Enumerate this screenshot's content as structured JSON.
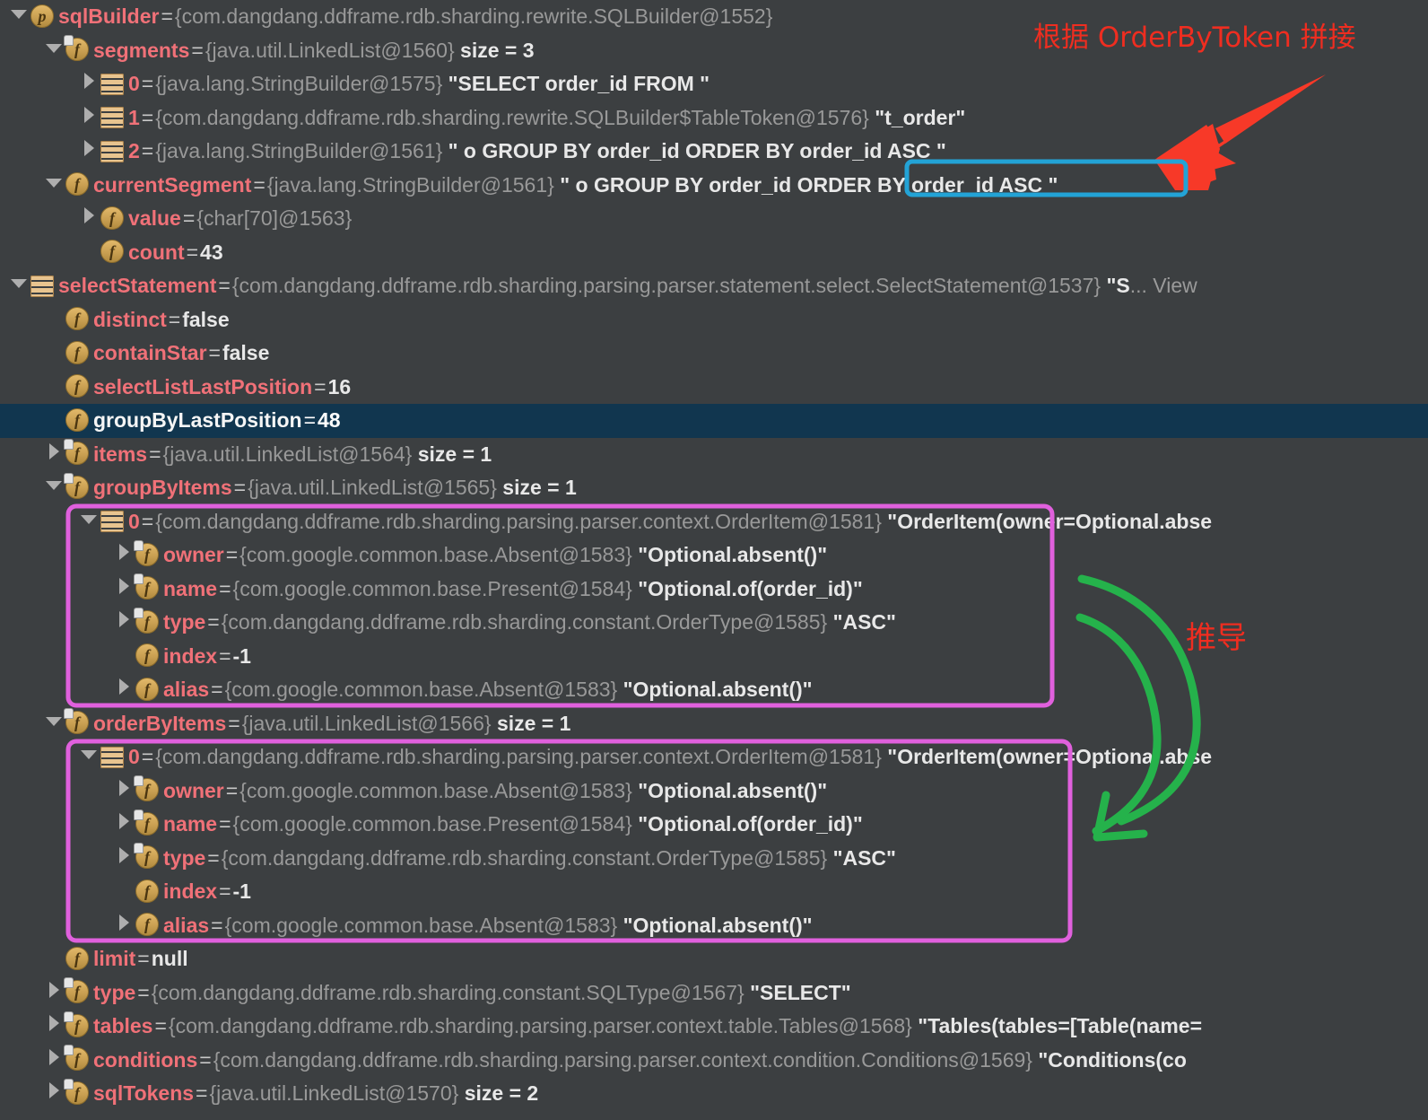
{
  "theme": {
    "background": "#3c3f41",
    "selected_row_bg": "#11364f",
    "field_name_color": "#f07178",
    "type_color": "#999999",
    "value_color": "#e8e8e8",
    "annotation_red": "#ef2d20",
    "highlight_cyan": "#23a3d6",
    "highlight_pink": "#e060dd",
    "arrow_green": "#25b24b"
  },
  "tree": {
    "rows": [
      {
        "indent": 0,
        "twisty": "down",
        "icon": "property-icon",
        "name": "sqlBuilder",
        "eq": "=",
        "type": "{com.dangdang.ddframe.rdb.sharding.rewrite.SQLBuilder@1552}",
        "value": "",
        "size": ""
      },
      {
        "indent": 1,
        "twisty": "down",
        "icon": "field-private-icon",
        "name": "segments",
        "eq": "=",
        "type": "{java.util.LinkedList@1560}",
        "value": "",
        "size": "size = 3"
      },
      {
        "indent": 2,
        "twisty": "right",
        "icon": "list-icon",
        "name": "0",
        "eq": "=",
        "type": "{java.lang.StringBuilder@1575}",
        "value": "\"SELECT order_id FROM \"",
        "size": ""
      },
      {
        "indent": 2,
        "twisty": "right",
        "icon": "list-icon",
        "name": "1",
        "eq": "=",
        "type": "{com.dangdang.ddframe.rdb.sharding.rewrite.SQLBuilder$TableToken@1576}",
        "value": "\"t_order\"",
        "size": ""
      },
      {
        "indent": 2,
        "twisty": "right",
        "icon": "list-icon",
        "name": "2",
        "eq": "=",
        "type": "{java.lang.StringBuilder@1561}",
        "value": "\" o GROUP BY order_id ORDER BY order_id ASC \"",
        "size": ""
      },
      {
        "indent": 1,
        "twisty": "down",
        "icon": "field-icon",
        "name": "currentSegment",
        "eq": "=",
        "type": "{java.lang.StringBuilder@1561}",
        "value": "\" o GROUP BY order_id ORDER BY order_id ASC \"",
        "size": ""
      },
      {
        "indent": 2,
        "twisty": "right",
        "icon": "field-icon",
        "name": "value",
        "eq": "=",
        "type": "{char[70]@1563}",
        "value": "",
        "size": ""
      },
      {
        "indent": 2,
        "twisty": "none",
        "icon": "field-icon",
        "name": "count",
        "eq": "=",
        "type": "",
        "value": "43",
        "size": ""
      },
      {
        "indent": 0,
        "twisty": "down",
        "icon": "list-icon",
        "name": "selectStatement",
        "eq": "=",
        "type": "{com.dangdang.ddframe.rdb.sharding.parsing.parser.statement.select.SelectStatement@1537}",
        "value": "\"S",
        "size": "",
        "trail": "... View"
      },
      {
        "indent": 1,
        "twisty": "none",
        "icon": "field-icon",
        "name": "distinct",
        "eq": "=",
        "type": "",
        "value": "false",
        "size": ""
      },
      {
        "indent": 1,
        "twisty": "none",
        "icon": "field-icon",
        "name": "containStar",
        "eq": "=",
        "type": "",
        "value": "false",
        "size": ""
      },
      {
        "indent": 1,
        "twisty": "none",
        "icon": "field-icon",
        "name": "selectListLastPosition",
        "eq": "=",
        "type": "",
        "value": "16",
        "size": ""
      },
      {
        "indent": 1,
        "twisty": "none",
        "icon": "field-icon",
        "name": "groupByLastPosition",
        "eq": "=",
        "type": "",
        "value": "48",
        "size": "",
        "selected": true
      },
      {
        "indent": 1,
        "twisty": "right",
        "icon": "field-private-icon",
        "name": "items",
        "eq": "=",
        "type": "{java.util.LinkedList@1564}",
        "value": "",
        "size": "size = 1"
      },
      {
        "indent": 1,
        "twisty": "down",
        "icon": "field-private-icon",
        "name": "groupByItems",
        "eq": "=",
        "type": "{java.util.LinkedList@1565}",
        "value": "",
        "size": "size = 1"
      },
      {
        "indent": 2,
        "twisty": "down",
        "icon": "list-icon",
        "name": "0",
        "eq": "=",
        "type": "{com.dangdang.ddframe.rdb.sharding.parsing.parser.context.OrderItem@1581}",
        "value": "\"OrderItem(owner=Optional.abse",
        "size": ""
      },
      {
        "indent": 3,
        "twisty": "right",
        "icon": "field-private-icon",
        "name": "owner",
        "eq": "=",
        "type": "{com.google.common.base.Absent@1583}",
        "value": "\"Optional.absent()\"",
        "size": ""
      },
      {
        "indent": 3,
        "twisty": "right",
        "icon": "field-private-icon",
        "name": "name",
        "eq": "=",
        "type": "{com.google.common.base.Present@1584}",
        "value": "\"Optional.of(order_id)\"",
        "size": ""
      },
      {
        "indent": 3,
        "twisty": "right",
        "icon": "field-private-icon",
        "name": "type",
        "eq": "=",
        "type": "{com.dangdang.ddframe.rdb.sharding.constant.OrderType@1585}",
        "value": "\"ASC\"",
        "size": ""
      },
      {
        "indent": 3,
        "twisty": "none",
        "icon": "field-icon",
        "name": "index",
        "eq": "=",
        "type": "",
        "value": "-1",
        "size": ""
      },
      {
        "indent": 3,
        "twisty": "right",
        "icon": "field-icon",
        "name": "alias",
        "eq": "=",
        "type": "{com.google.common.base.Absent@1583}",
        "value": "\"Optional.absent()\"",
        "size": ""
      },
      {
        "indent": 1,
        "twisty": "down",
        "icon": "field-private-icon",
        "name": "orderByItems",
        "eq": "=",
        "type": "{java.util.LinkedList@1566}",
        "value": "",
        "size": "size = 1"
      },
      {
        "indent": 2,
        "twisty": "down",
        "icon": "list-icon",
        "name": "0",
        "eq": "=",
        "type": "{com.dangdang.ddframe.rdb.sharding.parsing.parser.context.OrderItem@1581}",
        "value": "\"OrderItem(owner=Optional.abse",
        "size": ""
      },
      {
        "indent": 3,
        "twisty": "right",
        "icon": "field-private-icon",
        "name": "owner",
        "eq": "=",
        "type": "{com.google.common.base.Absent@1583}",
        "value": "\"Optional.absent()\"",
        "size": ""
      },
      {
        "indent": 3,
        "twisty": "right",
        "icon": "field-private-icon",
        "name": "name",
        "eq": "=",
        "type": "{com.google.common.base.Present@1584}",
        "value": "\"Optional.of(order_id)\"",
        "size": ""
      },
      {
        "indent": 3,
        "twisty": "right",
        "icon": "field-private-icon",
        "name": "type",
        "eq": "=",
        "type": "{com.dangdang.ddframe.rdb.sharding.constant.OrderType@1585}",
        "value": "\"ASC\"",
        "size": ""
      },
      {
        "indent": 3,
        "twisty": "none",
        "icon": "field-icon",
        "name": "index",
        "eq": "=",
        "type": "",
        "value": "-1",
        "size": ""
      },
      {
        "indent": 3,
        "twisty": "right",
        "icon": "field-icon",
        "name": "alias",
        "eq": "=",
        "type": "{com.google.common.base.Absent@1583}",
        "value": "\"Optional.absent()\"",
        "size": ""
      },
      {
        "indent": 1,
        "twisty": "none",
        "icon": "field-icon",
        "name": "limit",
        "eq": "=",
        "type": "",
        "value": "null",
        "size": ""
      },
      {
        "indent": 1,
        "twisty": "right",
        "icon": "field-private-icon",
        "name": "type",
        "eq": "=",
        "type": "{com.dangdang.ddframe.rdb.sharding.constant.SQLType@1567}",
        "value": "\"SELECT\"",
        "size": ""
      },
      {
        "indent": 1,
        "twisty": "right",
        "icon": "field-private-icon",
        "name": "tables",
        "eq": "=",
        "type": "{com.dangdang.ddframe.rdb.sharding.parsing.parser.context.table.Tables@1568}",
        "value": "\"Tables(tables=[Table(name=",
        "size": ""
      },
      {
        "indent": 1,
        "twisty": "right",
        "icon": "field-private-icon",
        "name": "conditions",
        "eq": "=",
        "type": "{com.dangdang.ddframe.rdb.sharding.parsing.parser.context.condition.Conditions@1569}",
        "value": "\"Conditions(co",
        "size": ""
      },
      {
        "indent": 1,
        "twisty": "right",
        "icon": "field-private-icon",
        "name": "sqlTokens",
        "eq": "=",
        "type": "{java.util.LinkedList@1570}",
        "value": "",
        "size": "size = 2"
      }
    ]
  },
  "annotations": {
    "order_by_token_note": "根据 OrderByToken 拼接",
    "derivation_note": "推导",
    "cyan_highlight_text": "ORDER BY order_id ASC",
    "pink_box_group_label": "groupByItems element 0",
    "pink_box_order_label": "orderByItems element 0"
  }
}
